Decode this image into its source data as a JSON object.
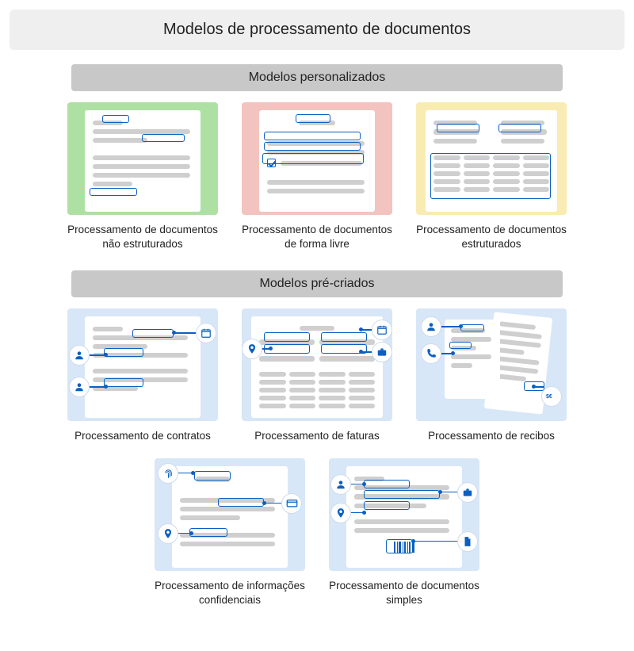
{
  "title": "Modelos de processamento de documentos",
  "section1": {
    "header": "Modelos personalizados"
  },
  "section2": {
    "header": "Modelos pré-criados"
  },
  "custom": {
    "items": [
      {
        "label": "Processamento de documentos não estruturados"
      },
      {
        "label": "Processamento de documentos de forma livre"
      },
      {
        "label": "Processamento de documentos estruturados"
      }
    ]
  },
  "prebuilt": {
    "items": [
      {
        "label": "Processamento de contratos"
      },
      {
        "label": "Processamento de faturas"
      },
      {
        "label": "Processamento de recibos"
      },
      {
        "label": "Processamento de informações confidenciais"
      },
      {
        "label": "Processamento de documentos simples"
      }
    ]
  },
  "icons": {
    "person": "person-icon",
    "calendar": "calendar-icon",
    "location": "location-pin-icon",
    "briefcase": "briefcase-icon",
    "phone": "phone-icon",
    "currency": "currency-icon",
    "fingerprint": "fingerprint-icon",
    "card": "card-icon",
    "document": "document-icon",
    "barcode": "barcode-icon"
  },
  "colors": {
    "green": "#aee0a3",
    "red": "#f3c3bf",
    "yellow": "#f9ecb2",
    "blue": "#d8e7f7",
    "line": "#cfcfcf",
    "accent": "#0a5fc2"
  }
}
